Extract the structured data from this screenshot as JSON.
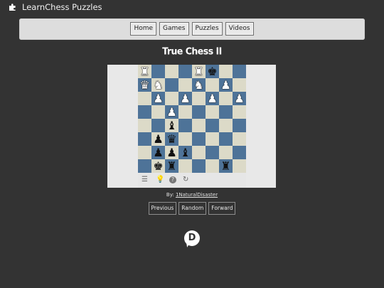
{
  "app": {
    "name": "LearnChess Puzzles"
  },
  "nav": {
    "items": [
      "Home",
      "Games",
      "Puzzles",
      "Videos"
    ]
  },
  "puzzle": {
    "title": "True Chess II",
    "author_prefix": "By:",
    "author": "1NaturalDisaster",
    "board": [
      [
        "wR",
        "",
        "",
        "",
        "wR",
        "bK",
        "",
        ""
      ],
      [
        "wQ",
        "wN",
        "",
        "",
        "wN",
        "",
        "wP",
        ""
      ],
      [
        "",
        "wP",
        "",
        "wP",
        "",
        "wP",
        "",
        "wP"
      ],
      [
        "",
        "",
        "wP",
        "",
        "",
        "",
        "",
        ""
      ],
      [
        "",
        "",
        "bB",
        "",
        "",
        "",
        "",
        ""
      ],
      [
        "",
        "bP",
        "bQ",
        "",
        "",
        "",
        "",
        ""
      ],
      [
        "",
        "bP",
        "bP",
        "bB",
        "",
        "",
        "",
        ""
      ],
      [
        "",
        "bK",
        "bR",
        "",
        "",
        "",
        "bR",
        ""
      ]
    ],
    "tools": [
      "menu-icon",
      "hint-icon",
      "help-icon",
      "reset-icon"
    ]
  },
  "pager": {
    "previous": "Previous",
    "random": "Random",
    "forward": "Forward"
  },
  "comments": {
    "logo_letter": "D"
  }
}
